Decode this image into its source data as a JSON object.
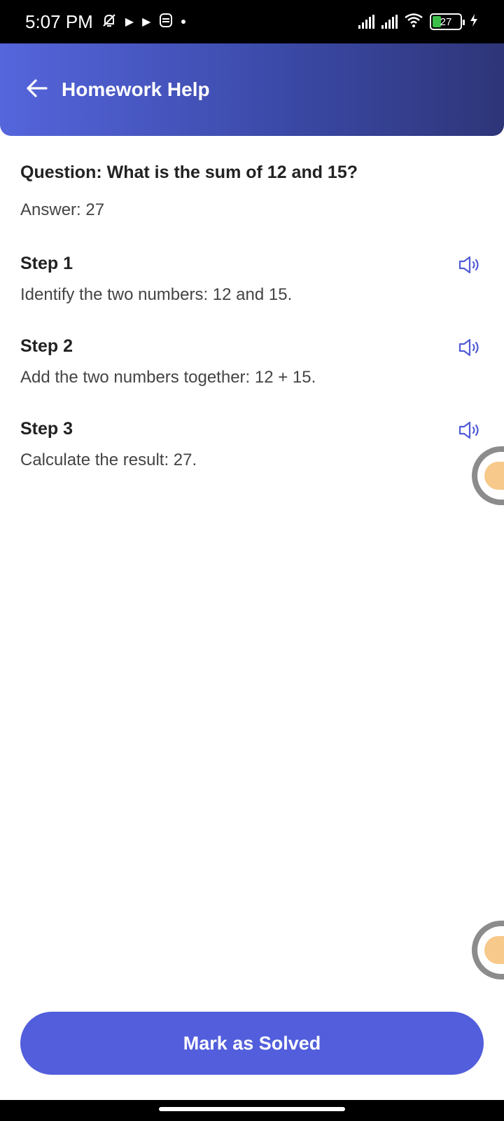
{
  "status_bar": {
    "time": "5:07 PM",
    "battery_level": "27",
    "icons": [
      "muted-bell-icon",
      "play-icon",
      "play-icon",
      "app-icon",
      "dot-icon",
      "signal-icon",
      "signal-icon",
      "wifi-icon",
      "battery-icon",
      "charging-icon"
    ]
  },
  "header": {
    "title": "Homework Help",
    "back_icon": "arrow-left-icon",
    "gradient": [
      "#5565dc",
      "#2e3578"
    ]
  },
  "question": {
    "text": "Question: What is the sum of 12 and 15?",
    "answer": "Answer: 27"
  },
  "steps": [
    {
      "title": "Step 1",
      "text": "Identify the two numbers: 12 and 15.",
      "icon": "speaker-icon"
    },
    {
      "title": "Step 2",
      "text": "Add the two numbers together: 12 + 15.",
      "icon": "speaker-icon"
    },
    {
      "title": "Step 3",
      "text": "Calculate the result: 27.",
      "icon": "speaker-icon"
    }
  ],
  "primary_button": {
    "label": "Mark as Solved",
    "color": "#525edc"
  },
  "accent_color": "#4f5bd5"
}
